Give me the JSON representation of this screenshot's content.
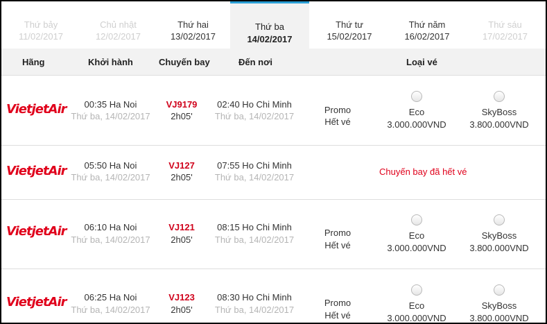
{
  "tabs": [
    {
      "day": "Thứ bảy",
      "date": "11/02/2017",
      "state": "disabled"
    },
    {
      "day": "Chủ nhật",
      "date": "12/02/2017",
      "state": "disabled"
    },
    {
      "day": "Thứ hai",
      "date": "13/02/2017",
      "state": "normal"
    },
    {
      "day": "Thứ ba",
      "date": "14/02/2017",
      "state": "active"
    },
    {
      "day": "Thứ tư",
      "date": "15/02/2017",
      "state": "normal"
    },
    {
      "day": "Thứ năm",
      "date": "16/02/2017",
      "state": "normal"
    },
    {
      "day": "Thứ sáu",
      "date": "17/02/2017",
      "state": "disabled"
    }
  ],
  "header": {
    "airline": "Hãng",
    "depart": "Khởi hành",
    "flight": "Chuyến bay",
    "arrive": "Đến nơi",
    "fare_type": "Loại vé"
  },
  "logo_text": "VietjetAir",
  "rows": [
    {
      "depart_time": "00:35 Ha Noi",
      "depart_date": "Thứ ba, 14/02/2017",
      "flight_no": "VJ9179",
      "duration": "2h05'",
      "arrive_time": "02:40 Ho Chi Minh",
      "arrive_date": "Thứ ba, 14/02/2017",
      "promo": "Promo",
      "promo_status": "Hết vé",
      "eco_label": "Eco",
      "eco_price": "3.000.000VND",
      "sky_label": "SkyBoss",
      "sky_price": "3.800.000VND"
    },
    {
      "depart_time": "05:50 Ha Noi",
      "depart_date": "Thứ ba, 14/02/2017",
      "flight_no": "VJ127",
      "duration": "2h05'",
      "arrive_time": "07:55 Ho Chi Minh",
      "arrive_date": "Thứ ba, 14/02/2017",
      "soldout": "Chuyến bay đã hết vé"
    },
    {
      "depart_time": "06:10 Ha Noi",
      "depart_date": "Thứ ba, 14/02/2017",
      "flight_no": "VJ121",
      "duration": "2h05'",
      "arrive_time": "08:15 Ho Chi Minh",
      "arrive_date": "Thứ ba, 14/02/2017",
      "promo": "Promo",
      "promo_status": "Hết vé",
      "eco_label": "Eco",
      "eco_price": "3.000.000VND",
      "sky_label": "SkyBoss",
      "sky_price": "3.800.000VND"
    },
    {
      "depart_time": "06:25 Ha Noi",
      "depart_date": "Thứ ba, 14/02/2017",
      "flight_no": "VJ123",
      "duration": "2h05'",
      "arrive_time": "08:30 Ho Chi Minh",
      "arrive_date": "Thứ ba, 14/02/2017",
      "promo": "Promo",
      "promo_status": "Hết vé",
      "eco_label": "Eco",
      "eco_price": "3.000.000VND",
      "sky_label": "SkyBoss",
      "sky_price": "3.800.000VND"
    }
  ]
}
